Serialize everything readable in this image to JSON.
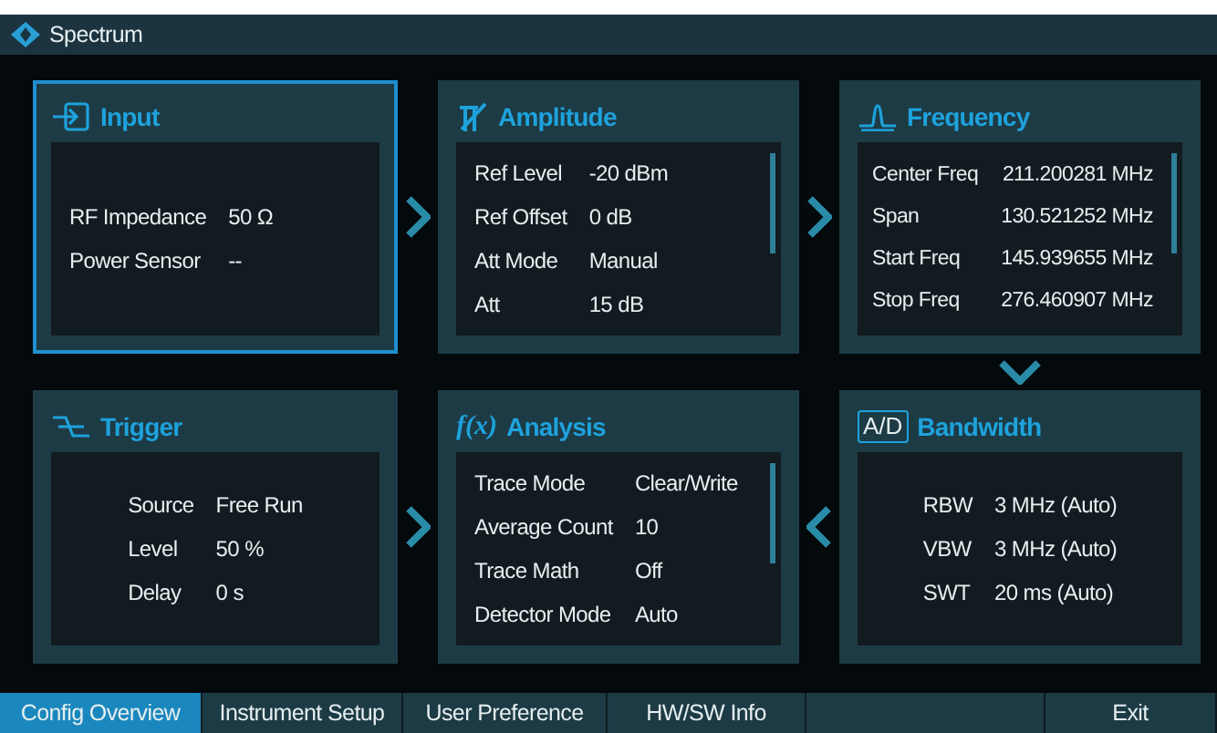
{
  "window": {
    "title": "Spectrum"
  },
  "cards": [
    {
      "kind": "input",
      "title": "Input",
      "selected": true,
      "scrollbar": false,
      "rows": [
        {
          "label": "RF Impedance",
          "value": "50 Ω"
        },
        {
          "label": "Power Sensor",
          "value": "--"
        }
      ]
    },
    {
      "kind": "amplitude",
      "title": "Amplitude",
      "selected": false,
      "scrollbar": true,
      "rows": [
        {
          "label": "Ref Level",
          "value": "-20 dBm"
        },
        {
          "label": "Ref Offset",
          "value": "0 dB"
        },
        {
          "label": "Att Mode",
          "value": "Manual"
        },
        {
          "label": "Att",
          "value": "15 dB"
        }
      ]
    },
    {
      "kind": "frequency",
      "title": "Frequency",
      "selected": false,
      "scrollbar": true,
      "rows": [
        {
          "label": "Center Freq",
          "value": "211.200281 MHz"
        },
        {
          "label": "Span",
          "value": "130.521252 MHz"
        },
        {
          "label": "Start Freq",
          "value": "145.939655 MHz"
        },
        {
          "label": "Stop Freq",
          "value": "276.460907 MHz"
        }
      ]
    },
    {
      "kind": "trigger",
      "title": "Trigger",
      "selected": false,
      "scrollbar": false,
      "rows": [
        {
          "label": "Source",
          "value": "Free Run"
        },
        {
          "label": "Level",
          "value": "50 %"
        },
        {
          "label": "Delay",
          "value": "0 s"
        }
      ]
    },
    {
      "kind": "analysis",
      "title": "Analysis",
      "icon_text": "f(x)",
      "selected": false,
      "scrollbar": true,
      "rows": [
        {
          "label": "Trace Mode",
          "value": "Clear/Write"
        },
        {
          "label": "Average Count",
          "value": "10"
        },
        {
          "label": "Trace Math",
          "value": "Off"
        },
        {
          "label": "Detector Mode",
          "value": "Auto"
        }
      ]
    },
    {
      "kind": "bandwidth",
      "title": "Bandwidth",
      "icon_text": "A/D",
      "selected": false,
      "scrollbar": false,
      "rows": [
        {
          "label": "RBW",
          "value": "3 MHz (Auto)"
        },
        {
          "label": "VBW",
          "value": "3 MHz (Auto)"
        },
        {
          "label": "SWT",
          "value": "20 ms (Auto)"
        }
      ]
    }
  ],
  "tabs": [
    {
      "label": "Config Overview",
      "selected": true
    },
    {
      "label": "Instrument Setup",
      "selected": false
    },
    {
      "label": "User Preference",
      "selected": false
    },
    {
      "label": "HW/SW Info",
      "selected": false
    },
    {
      "label": "Exit",
      "selected": false
    }
  ]
}
